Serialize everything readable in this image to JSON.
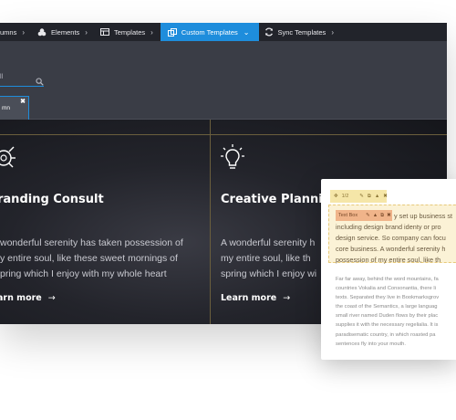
{
  "breadcrumbs": [
    {
      "label": "umns"
    },
    {
      "label": "Elements"
    },
    {
      "label": "Templates"
    },
    {
      "label": "Custom Templates"
    },
    {
      "label": "Sync Templates"
    }
  ],
  "panel": {
    "search_placeholder": "ll",
    "chip_label": "mn",
    "chip_close": "✖"
  },
  "cards": [
    {
      "title": "randing Consult",
      "lines": [
        "wonderful serenity has taken possession of",
        "y entire soul, like these sweet mornings of",
        "pring which I enjoy with my whole heart"
      ],
      "link": "arn more",
      "arrow": "→"
    },
    {
      "title": "Creative Planning",
      "lines": [
        "A wonderful serenity h",
        "my entire soul, like th",
        "spring which I enjoy wi"
      ],
      "link": "Learn more",
      "arrow": "→"
    }
  ],
  "popup": {
    "toolbar1_label": "1/2",
    "toolbar2_label": "Text Box",
    "highlight_lines": [
      "y set up business st",
      "including design brand identy or pro",
      "design service. So company can focu",
      "core business. A wonderful serenity h",
      "possession of my entire soul, like th"
    ],
    "paragraph": "Far far away, behind the word mountains, fa\ncountries Vokalia and Consonantia, there li\ntexts. Separated they live in Bookmarksgrov\nthe coast of the Semantics, a large languag\nsmall river named Duden flows by their plac\nsupplies it with the necessary regelialia. It is\nparadisematic country, in which roasted pa\nsentences fly into your mouth."
  },
  "colors": {
    "accent": "#1e8ddc",
    "gold_line": "#6b5f3d",
    "dark_bg": "#1e1f26"
  }
}
